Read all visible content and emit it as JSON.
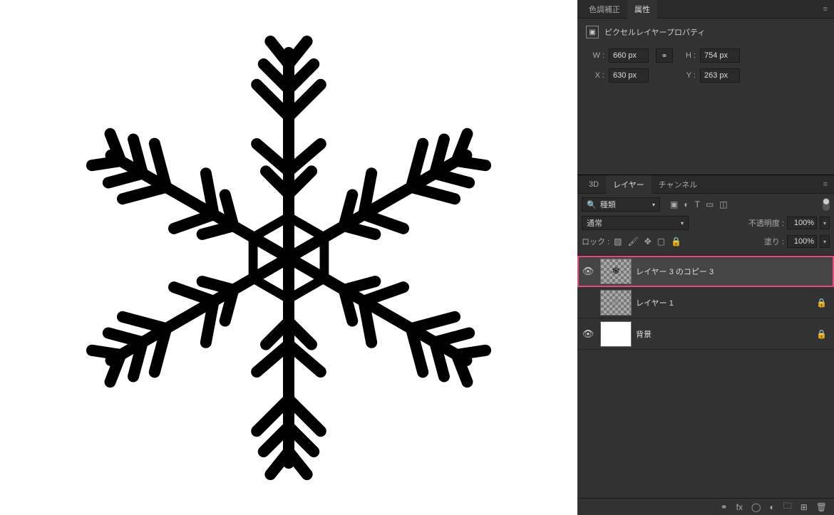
{
  "properties_panel": {
    "tabs": [
      {
        "label": "色調補正",
        "active": false
      },
      {
        "label": "属性",
        "active": true
      }
    ],
    "title": "ピクセルレイヤープロパティ",
    "w_label": "W :",
    "w_value": "660 px",
    "h_label": "H :",
    "h_value": "754 px",
    "x_label": "X :",
    "x_value": "630 px",
    "y_label": "Y :",
    "y_value": "263 px"
  },
  "layers_panel": {
    "tabs": [
      {
        "label": "3D",
        "active": false
      },
      {
        "label": "レイヤー",
        "active": true
      },
      {
        "label": "チャンネル",
        "active": false
      }
    ],
    "kind_label": "種類",
    "blend_mode": "通常",
    "opacity_label": "不透明度 :",
    "opacity_value": "100%",
    "lock_label": "ロック :",
    "fill_label": "塗り :",
    "fill_value": "100%",
    "layers": [
      {
        "name": "レイヤー 3 のコピー 3",
        "visible": true,
        "selected": true,
        "locked": false,
        "thumb": "snow"
      },
      {
        "name": "レイヤー 1",
        "visible": false,
        "selected": false,
        "locked": true,
        "thumb": "snow-faded"
      },
      {
        "name": "背景",
        "visible": true,
        "selected": false,
        "locked": true,
        "thumb": "white"
      }
    ]
  }
}
